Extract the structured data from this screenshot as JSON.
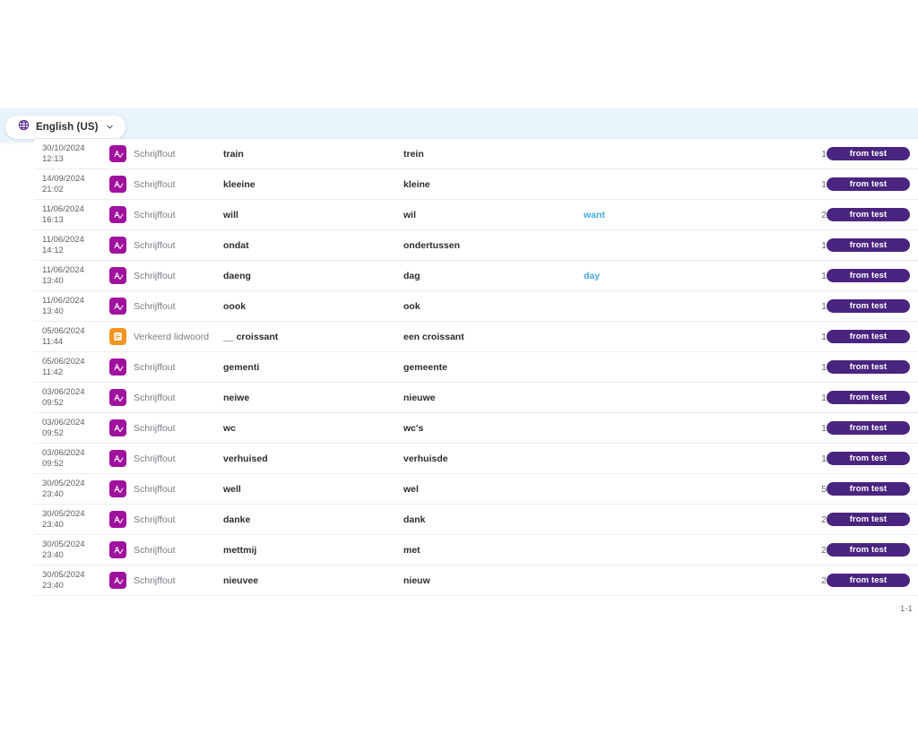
{
  "language_selector": {
    "label": "English (US)",
    "globe_icon": "globe-icon",
    "chevron_icon": "chevron-down-icon"
  },
  "colors": {
    "band_background": "#e8f4fb",
    "spelling_icon": "#a0129e",
    "article_icon": "#f49422",
    "badge": "#4a2580",
    "extra_text": "#44a8e0"
  },
  "table": {
    "rows": [
      {
        "date": "30/10/2024",
        "time": "12:13",
        "icon": "spelling",
        "type": "Schrijffout",
        "wrong": "train",
        "correct": "trein",
        "extra": "",
        "count": "1",
        "badge": "from test"
      },
      {
        "date": "14/09/2024",
        "time": "21:02",
        "icon": "spelling",
        "type": "Schrijffout",
        "wrong": "kleeine",
        "correct": "kleine",
        "extra": "",
        "count": "1",
        "badge": "from test"
      },
      {
        "date": "11/06/2024",
        "time": "16:13",
        "icon": "spelling",
        "type": "Schrijffout",
        "wrong": "will",
        "correct": "wil",
        "extra": "want",
        "count": "2",
        "badge": "from test"
      },
      {
        "date": "11/06/2024",
        "time": "14:12",
        "icon": "spelling",
        "type": "Schrijffout",
        "wrong": "ondat",
        "correct": "ondertussen",
        "extra": "",
        "count": "1",
        "badge": "from test"
      },
      {
        "date": "11/06/2024",
        "time": "13:40",
        "icon": "spelling",
        "type": "Schrijffout",
        "wrong": "daeng",
        "correct": "dag",
        "extra": "day",
        "count": "1",
        "badge": "from test"
      },
      {
        "date": "11/06/2024",
        "time": "13:40",
        "icon": "spelling",
        "type": "Schrijffout",
        "wrong": "oook",
        "correct": "ook",
        "extra": "",
        "count": "1",
        "badge": "from test"
      },
      {
        "date": "05/06/2024",
        "time": "11:44",
        "icon": "article",
        "type": "Verkeerd lidwoord",
        "wrong": "__ croissant",
        "correct": "een croissant",
        "extra": "",
        "count": "1",
        "badge": "from test"
      },
      {
        "date": "05/06/2024",
        "time": "11:42",
        "icon": "spelling",
        "type": "Schrijffout",
        "wrong": "gementi",
        "correct": "gemeente",
        "extra": "",
        "count": "1",
        "badge": "from test"
      },
      {
        "date": "03/06/2024",
        "time": "09:52",
        "icon": "spelling",
        "type": "Schrijffout",
        "wrong": "neiwe",
        "correct": "nieuwe",
        "extra": "",
        "count": "1",
        "badge": "from test"
      },
      {
        "date": "03/06/2024",
        "time": "09:52",
        "icon": "spelling",
        "type": "Schrijffout",
        "wrong": "wc",
        "correct": "wc's",
        "extra": "",
        "count": "1",
        "badge": "from test"
      },
      {
        "date": "03/06/2024",
        "time": "09:52",
        "icon": "spelling",
        "type": "Schrijffout",
        "wrong": "verhuised",
        "correct": "verhuisde",
        "extra": "",
        "count": "1",
        "badge": "from test"
      },
      {
        "date": "30/05/2024",
        "time": "23:40",
        "icon": "spelling",
        "type": "Schrijffout",
        "wrong": "well",
        "correct": "wel",
        "extra": "",
        "count": "5",
        "badge": "from test"
      },
      {
        "date": "30/05/2024",
        "time": "23:40",
        "icon": "spelling",
        "type": "Schrijffout",
        "wrong": "danke",
        "correct": "dank",
        "extra": "",
        "count": "2",
        "badge": "from test"
      },
      {
        "date": "30/05/2024",
        "time": "23:40",
        "icon": "spelling",
        "type": "Schrijffout",
        "wrong": "mettmij",
        "correct": "met",
        "extra": "",
        "count": "2",
        "badge": "from test"
      },
      {
        "date": "30/05/2024",
        "time": "23:40",
        "icon": "spelling",
        "type": "Schrijffout",
        "wrong": "nieuvee",
        "correct": "nieuw",
        "extra": "",
        "count": "2",
        "badge": "from test"
      }
    ],
    "pagination": "1-1"
  }
}
